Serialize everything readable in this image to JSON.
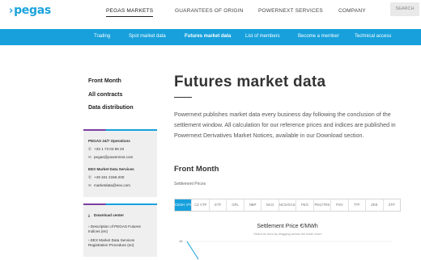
{
  "header": {
    "logo_text": "pegas",
    "logo_chevron": "›",
    "nav": [
      "PEGAS MARKETS",
      "GUARANTEES OF ORIGIN",
      "POWERNEXT SERVICES",
      "COMPANY"
    ],
    "search_placeholder": "SEARCH"
  },
  "subnav": {
    "items": [
      "Trading",
      "Spot market data",
      "Futures market data",
      "List of members",
      "Become a member",
      "Technical access"
    ],
    "active": "Futures market data"
  },
  "sidebar": {
    "links": [
      "Front Month",
      "All contracts",
      "Data distribution"
    ],
    "contact": {
      "ops_title": "PEGAS 24/7 Operations",
      "ops_phone": "+33 1 73 03 96 20",
      "ops_email": "pegas@powernext.com",
      "eex_title": "EEX Market Data Services",
      "eex_phone": "+49 341 2156-200",
      "eex_email": "marketdata@eex.com"
    },
    "downloads": {
      "title": "Download center",
      "items": [
        "Description of PEGAS Futures Indices (en)",
        "EEX Market Data Services Registration Procedure (en)"
      ]
    }
  },
  "main": {
    "title": "Futures market data",
    "intro": "Powernext publishes market data every business day following the conclusion of the settlement window. All calculation for our reference prices and indices are published in Powernext Derivatives Market Notices, available in our Download section.",
    "section_title": "Front Month",
    "settlement_label": "Settlement Prices",
    "hubs": [
      "CEGH VTP",
      "CZ VTP",
      "ETF",
      "GPL",
      "NBP",
      "NCG",
      "NCG/GASPOOL",
      "PEG",
      "PEG/TRS",
      "PSV",
      "TTF",
      "ZEE",
      "ZTP"
    ],
    "active_hub": "CEGH VTP"
  },
  "chart_data": {
    "type": "line",
    "title": "Settlement Price €/MWh",
    "subtitle": "Select an area by dragging across the lower chart",
    "y_tick_label": "16",
    "series": [
      {
        "values": [
          16,
          14
        ]
      }
    ]
  },
  "colors": {
    "brand_blue": "#17a0dc",
    "accent_purple": "#7b3fa0",
    "card_bg": "#efefef"
  }
}
